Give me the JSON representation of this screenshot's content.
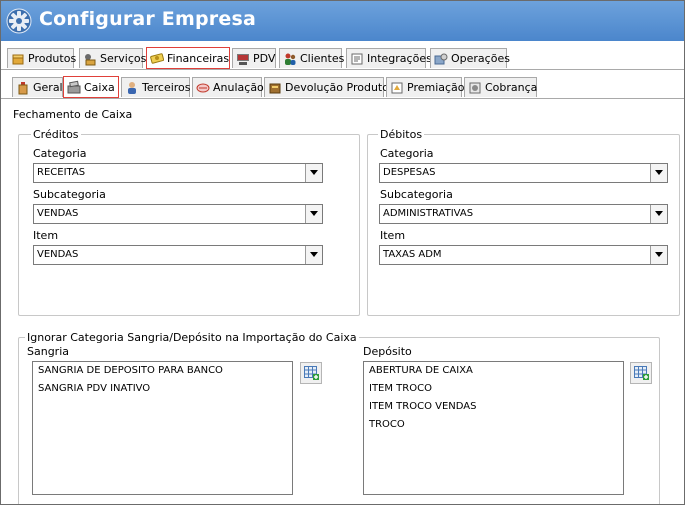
{
  "window": {
    "title": "Configurar Empresa"
  },
  "main_tabs": [
    {
      "label": "Produtos",
      "icon": "box-icon",
      "active": false
    },
    {
      "label": "Serviços",
      "icon": "services-icon",
      "active": false
    },
    {
      "label": "Financeiras",
      "icon": "money-icon",
      "active": true
    },
    {
      "label": "PDV",
      "icon": "pdv-icon",
      "active": false
    },
    {
      "label": "Clientes",
      "icon": "clients-icon",
      "active": false
    },
    {
      "label": "Integrações",
      "icon": "integration-icon",
      "active": false
    },
    {
      "label": "Operações",
      "icon": "operations-icon",
      "active": false
    }
  ],
  "sub_tabs": [
    {
      "label": "Geral",
      "icon": "general-icon",
      "active": false
    },
    {
      "label": "Caixa",
      "icon": "cash-register-icon",
      "active": true
    },
    {
      "label": "Terceiros",
      "icon": "person-icon",
      "active": false
    },
    {
      "label": "Anulação",
      "icon": "cancel-icon",
      "active": false
    },
    {
      "label": "Devolução Produto",
      "icon": "return-icon",
      "active": false
    },
    {
      "label": "Premiação",
      "icon": "award-icon",
      "active": false
    },
    {
      "label": "Cobrança",
      "icon": "billing-icon",
      "active": false
    }
  ],
  "fechamento": {
    "title": "Fechamento de Caixa",
    "creditos": {
      "title": "Créditos",
      "categoria_label": "Categoria",
      "categoria_value": "RECEITAS",
      "subcategoria_label": "Subcategoria",
      "subcategoria_value": "VENDAS",
      "item_label": "Item",
      "item_value": "VENDAS"
    },
    "debitos": {
      "title": "Débitos",
      "categoria_label": "Categoria",
      "categoria_value": "DESPESAS",
      "subcategoria_label": "Subcategoria",
      "subcategoria_value": "ADMINISTRATIVAS",
      "item_label": "Item",
      "item_value": "TAXAS ADM"
    }
  },
  "ignorar": {
    "title": "Ignorar Categoria Sangria/Depósito na Importação do Caixa",
    "sangria": {
      "label": "Sangria",
      "items": [
        "SANGRIA DE DEPOSITO PARA BANCO",
        "SANGRIA PDV INATIVO"
      ]
    },
    "deposito": {
      "label": "Depósito",
      "items": [
        "ABERTURA DE CAIXA",
        "ITEM TROCO",
        "ITEM TROCO VENDAS",
        "TROCO"
      ]
    }
  }
}
